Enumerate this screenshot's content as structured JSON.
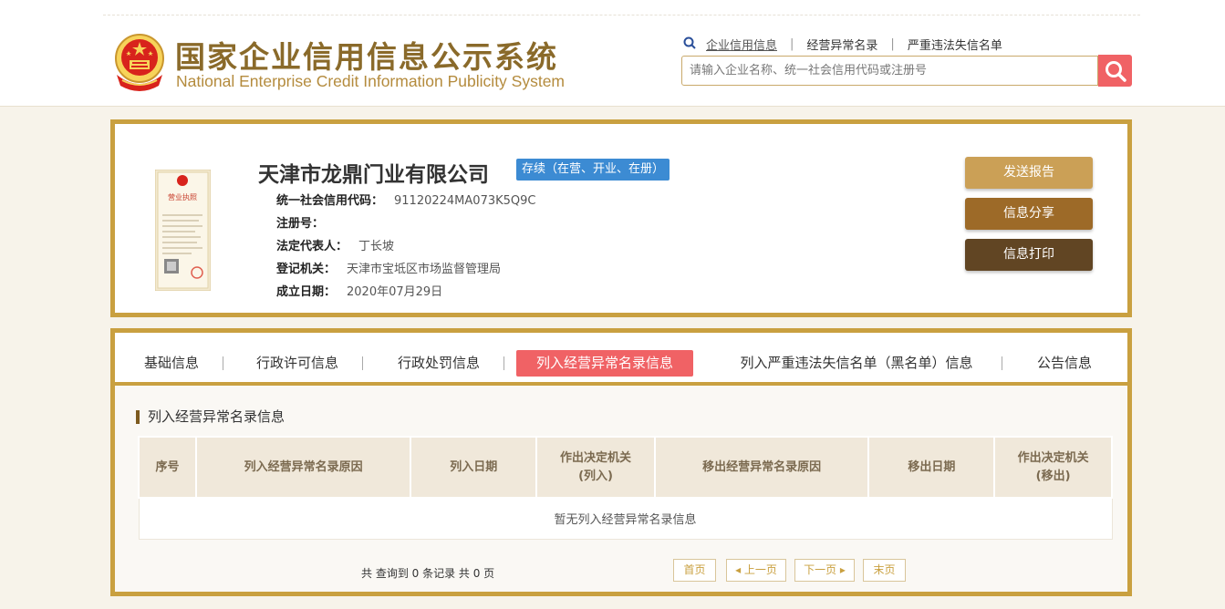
{
  "header": {
    "title_cn": "国家企业信用信息公示系统",
    "title_en": "National Enterprise Credit Information Publicity System",
    "nav": [
      "企业信用信息",
      "经营异常名录",
      "严重违法失信名单"
    ],
    "search_placeholder": "请输入企业名称、统一社会信用代码或注册号"
  },
  "company": {
    "name": "天津市龙鼎门业有限公司",
    "status": "存续（在营、开业、在册）",
    "license_title": "营业执照",
    "fields": [
      {
        "label": "统一社会信用代码：",
        "value": "91120224MA073K5Q9C"
      },
      {
        "label": "注册号：",
        "value": ""
      },
      {
        "label": "法定代表人：",
        "value": "丁长坡"
      },
      {
        "label": "登记机关：",
        "value": "天津市宝坻区市场监督管理局"
      },
      {
        "label": "成立日期：",
        "value": "2020年07月29日"
      }
    ]
  },
  "actions": {
    "report": "发送报告",
    "share": "信息分享",
    "print": "信息打印"
  },
  "tabs": [
    "基础信息",
    "行政许可信息",
    "行政处罚信息",
    "列入经营异常名录信息",
    "列入严重违法失信名单（黑名单）信息",
    "公告信息"
  ],
  "active_tab": "列入经营异常名录信息",
  "section": {
    "title": "列入经营异常名录信息",
    "columns": [
      "序号",
      "列入经营异常名录原因",
      "列入日期",
      "作出决定机关\n(列入)",
      "移出经营异常名录原因",
      "移出日期",
      "作出决定机关\n(移出)"
    ],
    "empty_text": "暂无列入经营异常名录信息"
  },
  "pager": {
    "summary": "共 查询到 0 条记录 共 0 页",
    "first": "首页",
    "prev": "上一页",
    "next": "下一页",
    "last": "末页"
  },
  "colors": {
    "gold_border": "#c9a040",
    "active_tab": "#f06265",
    "status_badge": "#3c8bd3",
    "btn_report": "#cba056",
    "btn_share": "#9d6a28",
    "btn_print": "#614523"
  }
}
